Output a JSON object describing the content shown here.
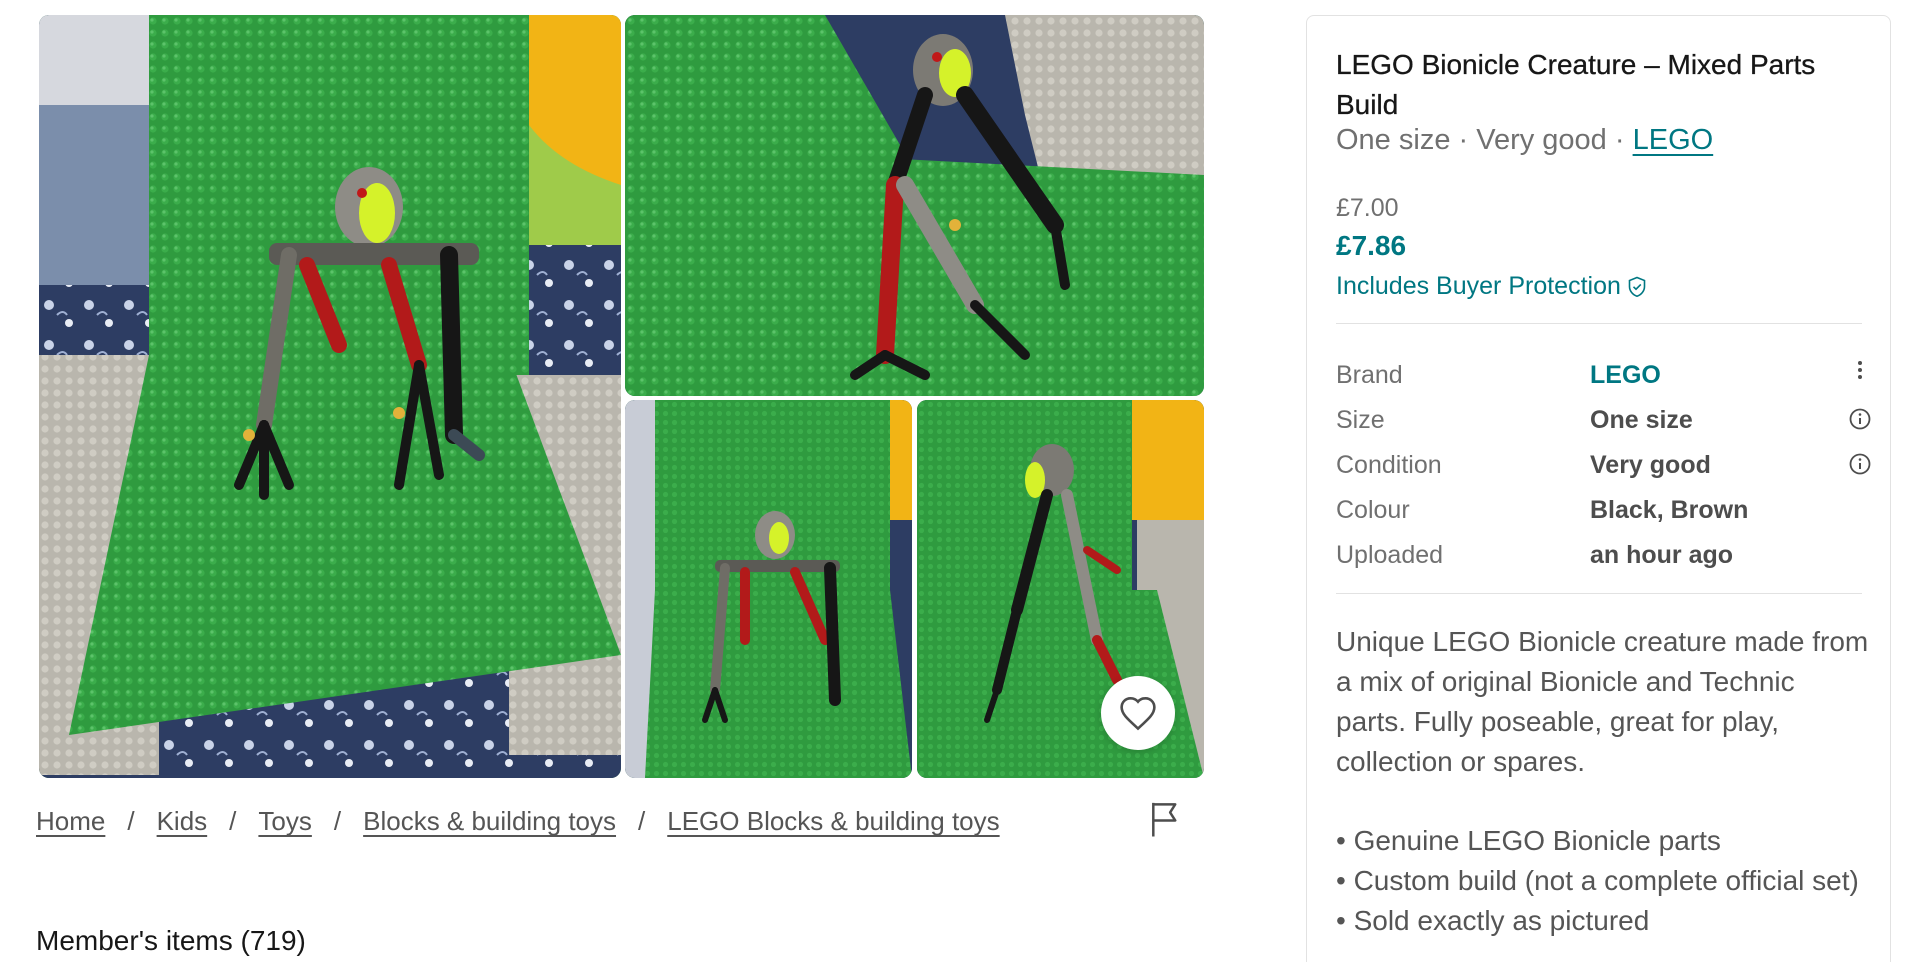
{
  "gallery": {
    "photos": [
      {
        "name": "photo-main",
        "subject": "LEGO Bionicle creature standing on green baseplate, front view"
      },
      {
        "name": "photo-side",
        "subject": "LEGO Bionicle creature side view"
      },
      {
        "name": "photo-small-front",
        "subject": "LEGO Bionicle creature front view"
      },
      {
        "name": "photo-small-side",
        "subject": "LEGO Bionicle creature three-quarter view"
      }
    ],
    "favourite_icon": "heart-icon"
  },
  "breadcrumb": {
    "items": [
      "Home",
      "Kids",
      "Toys",
      "Blocks & building toys",
      "LEGO Blocks & building toys"
    ],
    "separator": "/",
    "report_icon": "flag-icon"
  },
  "members": {
    "label": "Member's items (719)"
  },
  "item": {
    "title": "LEGO Bionicle Creature – Mixed Parts Build",
    "subline_prefix": "One size · Very good · ",
    "subline_brand": "LEGO",
    "price": "£7.00",
    "price_with_protection": "£7.86",
    "protection_label": "Includes Buyer Protection",
    "protection_icon": "shield-check-icon",
    "specs": [
      {
        "label": "Brand",
        "value": "LEGO",
        "icon": "more-vertical-icon"
      },
      {
        "label": "Size",
        "value": "One size",
        "icon": "info-icon"
      },
      {
        "label": "Condition",
        "value": "Very good",
        "icon": "info-icon"
      },
      {
        "label": "Colour",
        "value": "Black, Brown"
      },
      {
        "label": "Uploaded",
        "value": "an hour ago"
      }
    ],
    "description": "Unique LEGO Bionicle creature made from a mix of original Bionicle and Technic parts. Fully poseable, great for play, collection or spares.",
    "bullets": [
      "• Genuine LEGO Bionicle parts",
      "• Custom build (not a complete official set)",
      "• Sold exactly as pictured"
    ]
  },
  "colors": {
    "accent": "#007782",
    "muted_text": "#707070",
    "baseplate_green": "#2f9b3f"
  }
}
